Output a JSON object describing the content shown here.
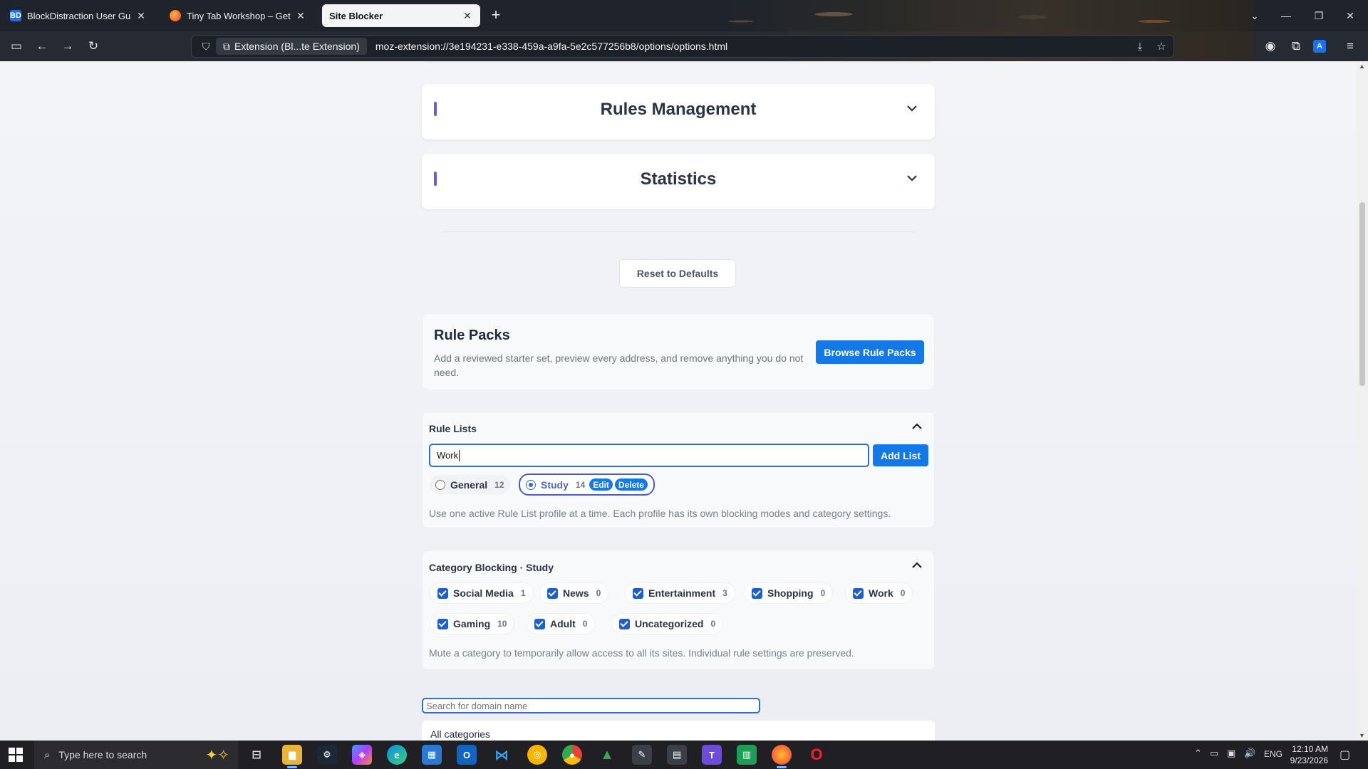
{
  "browser": {
    "tabs": [
      {
        "title": "BlockDistraction User Guide: Ru",
        "favicon": "BD",
        "favicon_color": "#1a73e8",
        "active": false
      },
      {
        "title": "Tiny Tab Workshop – Get this Th",
        "favicon": "",
        "favicon_color": "#ff6d2a",
        "active": false
      },
      {
        "title": "Site Blocker",
        "favicon": "",
        "favicon_color": "",
        "active": true
      }
    ],
    "url_chip": "Extension (Bl...te Extension)",
    "url": "moz-extension://3e194231-e338-459a-a9fa-5e2c577256b8/options/options.html"
  },
  "accordions": [
    {
      "title": "Rules Management"
    },
    {
      "title": "Statistics"
    }
  ],
  "reset_label": "Reset to Defaults",
  "rule_packs": {
    "title": "Rule Packs",
    "description": "Add a reviewed starter set, preview every address, and remove anything you do not need.",
    "browse_label": "Browse Rule Packs"
  },
  "rule_lists": {
    "title": "Rule Lists",
    "input_value": "Work",
    "add_label": "Add List",
    "lists": [
      {
        "name": "General",
        "count": "12",
        "selected": false
      },
      {
        "name": "Study",
        "count": "14",
        "selected": true
      }
    ],
    "edit_label": "Edit",
    "delete_label": "Delete",
    "help": "Use one active Rule List profile at a time. Each profile has its own blocking modes and category settings."
  },
  "category_blocking": {
    "title": "Category Blocking · Study",
    "categories": [
      {
        "name": "Social Media",
        "count": "1",
        "checked": true
      },
      {
        "name": "News",
        "count": "0",
        "checked": true
      },
      {
        "name": "Entertainment",
        "count": "3",
        "checked": true
      },
      {
        "name": "Shopping",
        "count": "0",
        "checked": true
      },
      {
        "name": "Work",
        "count": "0",
        "checked": true
      },
      {
        "name": "Gaming",
        "count": "10",
        "checked": true
      },
      {
        "name": "Adult",
        "count": "0",
        "checked": true
      },
      {
        "name": "Uncategorized",
        "count": "0",
        "checked": true
      }
    ],
    "help": "Mute a category to temporarily allow access to all its sites. Individual rule settings are preserved."
  },
  "search": {
    "placeholder": "Search for domain name"
  },
  "filter": {
    "selected": "All categories"
  },
  "taskbar": {
    "search_placeholder": "Type here to search",
    "language": "ENG",
    "time": "12:10 AM",
    "date": "9/23/2026"
  },
  "colors": {
    "accent": "#1479e6",
    "section_accent": "#6a5bd6",
    "active_list": "#4a5cc9"
  }
}
